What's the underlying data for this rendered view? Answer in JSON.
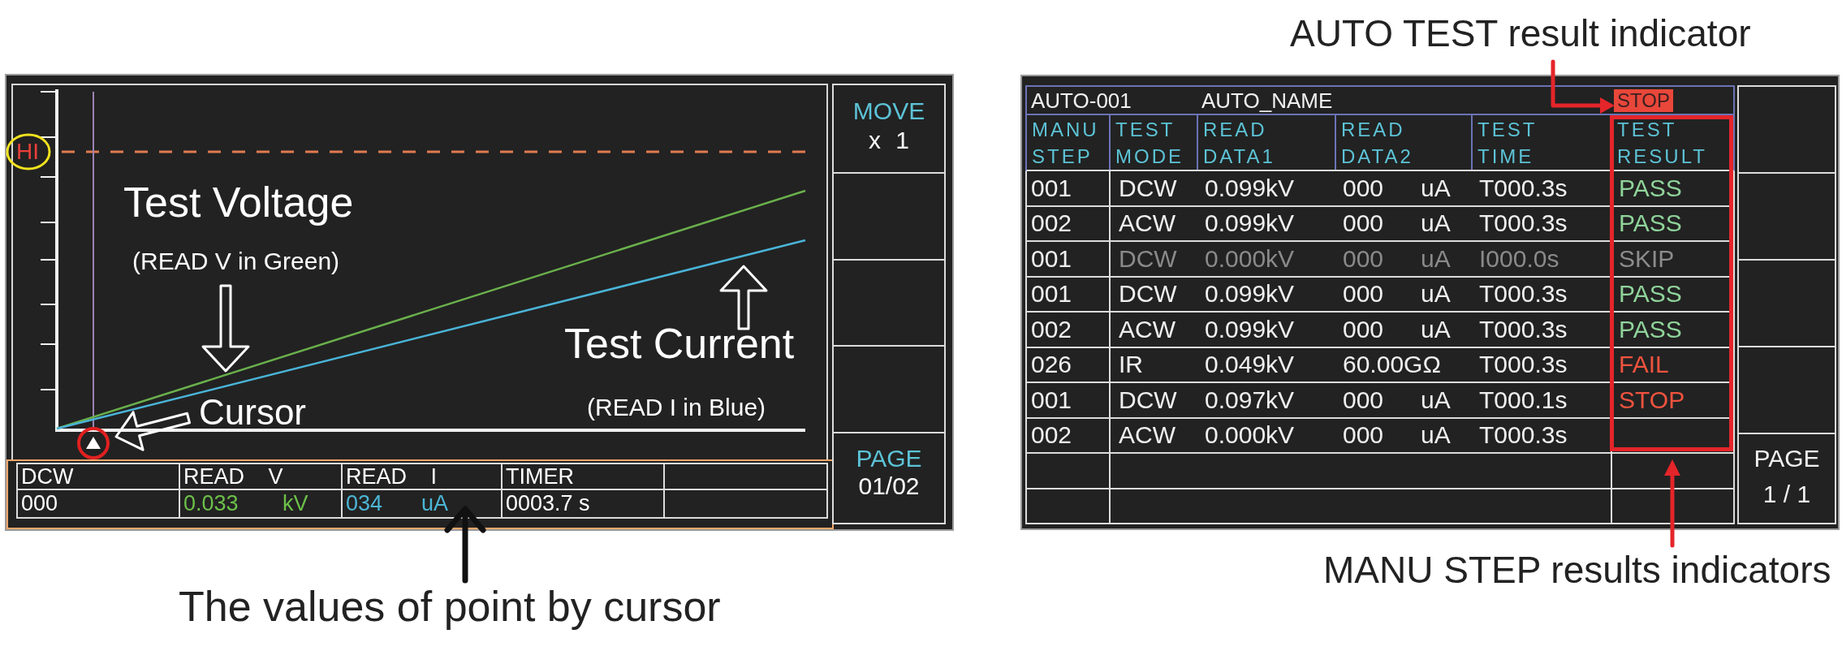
{
  "cursor_screen": {
    "hi_label": "HI",
    "voltage_title": "Test Voltage",
    "voltage_note": "(READ V in Green)",
    "current_title": "Test Current",
    "current_note": "(READ I in Blue)",
    "cursor_label": "Cursor",
    "readout": {
      "headers": [
        "DCW",
        "READ V",
        "READ I",
        "TIMER"
      ],
      "values": [
        {
          "text": "000",
          "color": "#ffffff"
        },
        {
          "text": "0.033",
          "unit": "kV",
          "color": "#6cc04a"
        },
        {
          "text": "034",
          "unit": "uA",
          "color": "#4cb6d6"
        },
        {
          "text": "0003.7 s",
          "color": "#ffffff"
        }
      ]
    },
    "move_key": {
      "label": "MOVE",
      "value": "x 1"
    },
    "page_key": {
      "label": "PAGE",
      "value": "01/02"
    }
  },
  "cursor_caption": "The values of point by cursor",
  "auto_result_caption": "AUTO TEST result indicator",
  "result_screen": {
    "auto_id": "AUTO-001",
    "auto_name": "AUTO_NAME",
    "auto_result": {
      "text": "STOP",
      "kind": "stop"
    },
    "columns": [
      {
        "lines": [
          "MANU",
          "STEP"
        ]
      },
      {
        "lines": [
          "TEST",
          "MODE"
        ]
      },
      {
        "lines": [
          "READ",
          "DATA1"
        ]
      },
      {
        "lines": [
          "READ",
          "DATA2"
        ]
      },
      {
        "lines": [
          "TEST",
          "TIME"
        ]
      },
      {
        "lines": [
          "TEST",
          "RESULT"
        ]
      }
    ],
    "rows": [
      {
        "step": "001",
        "mode": "DCW",
        "data1": "0.099kV",
        "data2": "000",
        "unit": "uA",
        "time": "T000.3s",
        "skipped": false,
        "result": {
          "text": "PASS",
          "kind": "pass"
        }
      },
      {
        "step": "002",
        "mode": "ACW",
        "data1": "0.099kV",
        "data2": "000",
        "unit": "uA",
        "time": "T000.3s",
        "skipped": false,
        "result": {
          "text": "PASS",
          "kind": "pass"
        }
      },
      {
        "step": "001",
        "mode": "DCW",
        "data1": "0.000kV",
        "data2": "000",
        "unit": "uA",
        "time": "I000.0s",
        "skipped": true,
        "result": {
          "text": "SKIP",
          "kind": "skip"
        }
      },
      {
        "step": "001",
        "mode": "DCW",
        "data1": "0.099kV",
        "data2": "000",
        "unit": "uA",
        "time": "T000.3s",
        "skipped": false,
        "result": {
          "text": "PASS",
          "kind": "pass"
        }
      },
      {
        "step": "002",
        "mode": "ACW",
        "data1": "0.099kV",
        "data2": "000",
        "unit": "uA",
        "time": "T000.3s",
        "skipped": false,
        "result": {
          "text": "PASS",
          "kind": "pass"
        }
      },
      {
        "step": "026",
        "mode": "IR",
        "data1": "0.049kV",
        "data2": "60.00GΩ",
        "time": "T000.3s",
        "skipped": false,
        "result": {
          "text": "FAIL",
          "kind": "fail"
        }
      },
      {
        "step": "001",
        "mode": "DCW",
        "data1": "0.097kV",
        "data2": "000",
        "unit": "uA",
        "time": "T000.1s",
        "skipped": false,
        "result": {
          "text": "STOP",
          "kind": "stop"
        }
      },
      {
        "step": "002",
        "mode": "ACW",
        "data1": "0.000kV",
        "data2": "000",
        "unit": "uA",
        "time": "T000.3s",
        "skipped": false
      }
    ],
    "page_key": {
      "label": "PAGE",
      "value": "1 / 1"
    }
  },
  "step_results_caption": "MANU STEP results indicators"
}
